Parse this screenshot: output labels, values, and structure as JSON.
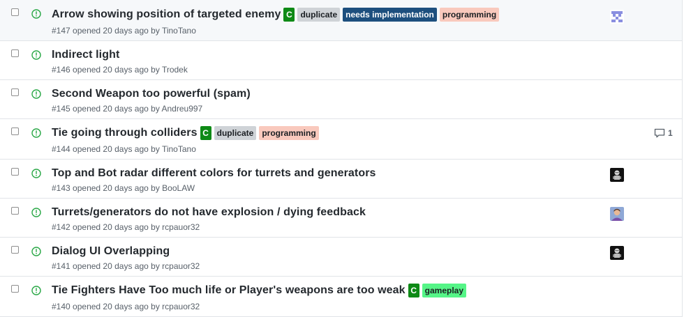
{
  "issues": [
    {
      "title": "Arrow showing position of targeted enemy",
      "number": "#147",
      "opened": "opened 20 days ago by",
      "author": "TinoTano",
      "labels": {
        "c": "C",
        "duplicate": "duplicate",
        "needs": "needs implementation",
        "programming": "programming"
      },
      "avatar": "pixel-blue-avatar"
    },
    {
      "title": "Indirect light",
      "number": "#146",
      "opened": "opened 20 days ago by",
      "author": "Trodek"
    },
    {
      "title": "Second Weapon too powerful (spam)",
      "number": "#145",
      "opened": "opened 20 days ago by",
      "author": "Andreu997"
    },
    {
      "title": "Tie going through colliders",
      "number": "#144",
      "opened": "opened 20 days ago by",
      "author": "TinoTano",
      "labels": {
        "c": "C",
        "duplicate": "duplicate",
        "programming": "programming"
      },
      "comments": "1"
    },
    {
      "title": "Top and Bot radar different colors for turrets and generators",
      "number": "#143",
      "opened": "opened 20 days ago by",
      "author": "BooLAW",
      "avatar": "dark-character-avatar"
    },
    {
      "title": "Turrets/generators do not have explosion / dying feedback",
      "number": "#142",
      "opened": "opened 20 days ago by",
      "author": "rcpauor32",
      "avatar": "person-photo-avatar"
    },
    {
      "title": "Dialog UI Overlapping",
      "number": "#141",
      "opened": "opened 20 days ago by",
      "author": "rcpauor32",
      "avatar": "dark-character-avatar"
    },
    {
      "title": "Tie Fighters Have Too much life or Player's weapons are too weak",
      "number": "#140",
      "opened": "opened 20 days ago by",
      "author": "rcpauor32",
      "labels": {
        "c": "C",
        "gameplay": "gameplay"
      }
    }
  ],
  "colors": {
    "open_icon": "#28a745",
    "label_c": "#0e8a16",
    "label_duplicate": "#cfd3d7",
    "label_needs_implementation": "#1d4f7e",
    "label_programming": "#f9c9bd",
    "label_gameplay": "#55f587"
  }
}
